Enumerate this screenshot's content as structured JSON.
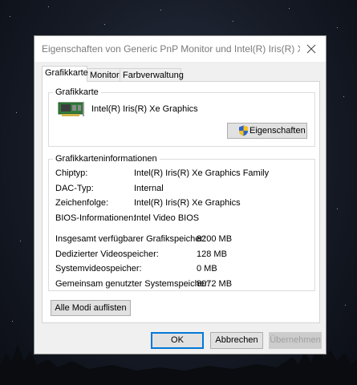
{
  "window": {
    "title": "Eigenschaften von Generic PnP Monitor und Intel(R) Iris(R) Xe ..."
  },
  "tabs": [
    {
      "label": "Grafikkarte",
      "active": true
    },
    {
      "label": "Monitor",
      "active": false
    },
    {
      "label": "Farbverwaltung",
      "active": false
    }
  ],
  "adapter_group": {
    "label": "Grafikkarte",
    "adapter_name": "Intel(R) Iris(R) Xe Graphics",
    "properties_button": "Eigenschaften"
  },
  "info_group": {
    "label": "Grafikkarteninformationen",
    "rows": [
      {
        "label": "Chiptyp:",
        "value": "Intel(R) Iris(R) Xe Graphics Family"
      },
      {
        "label": "DAC-Typ:",
        "value": "Internal"
      },
      {
        "label": "Zeichenfolge:",
        "value": "Intel(R) Iris(R) Xe Graphics"
      },
      {
        "label": "BIOS-Informationen:",
        "value": "Intel Video BIOS"
      }
    ],
    "memory": [
      {
        "label": "Insgesamt verfügbarer Grafikspeicher:",
        "value": "8200 MB"
      },
      {
        "label": "Dedizierter Videospeicher:",
        "value": "128 MB"
      },
      {
        "label": "Systemvideospeicher:",
        "value": "0 MB"
      },
      {
        "label": "Gemeinsam genutzter Systemspeicher:",
        "value": "8072 MB"
      }
    ]
  },
  "list_modes_button": "Alle Modi auflisten",
  "footer": {
    "ok": "OK",
    "cancel": "Abbrechen",
    "apply": "Übernehmen"
  },
  "colors": {
    "accent": "#0078d7",
    "dialog_bg": "#f0f0f0"
  }
}
